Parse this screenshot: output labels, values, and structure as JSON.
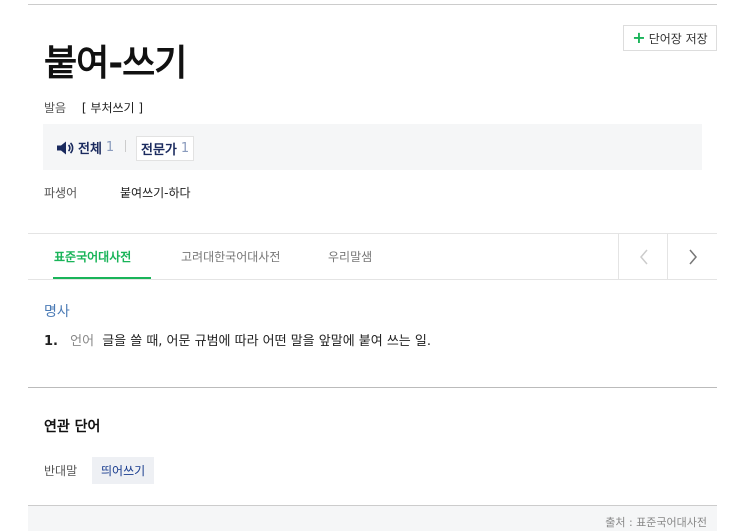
{
  "entry": {
    "headword": "붙여-쓰기",
    "save_button_label": "단어장 저장",
    "pronunciation_label": "발음",
    "pronunciation_value": "[ 부처쓰기 ]",
    "pron_all_label": "전체",
    "pron_all_count": "1",
    "pron_expert_label": "전문가",
    "pron_expert_count": "1",
    "derived_label": "파생어",
    "derived_value": "붙여쓰기-하다"
  },
  "tabs": [
    {
      "label": "표준국어대사전"
    },
    {
      "label": "고려대한국어대사전"
    },
    {
      "label": "우리말샘"
    }
  ],
  "definition": {
    "part_of_speech": "명사",
    "number": "1.",
    "field": "언어",
    "text": "글을 쓸 때, 어문 규범에 따라 어떤 말을 앞말에 붙여 쓰는 일."
  },
  "related": {
    "title": "연관 단어",
    "antonym_label": "반대말",
    "antonym_value": "띄어쓰기"
  },
  "footer": {
    "source": "출처 : 표준국어대사전"
  },
  "colors": {
    "accent_green": "#19b459",
    "pos_blue": "#4a7ab5",
    "link_blue": "#1a3d8f"
  },
  "icons": [
    "plus-icon",
    "speaker-icon",
    "chevron-left-icon",
    "chevron-right-icon"
  ]
}
